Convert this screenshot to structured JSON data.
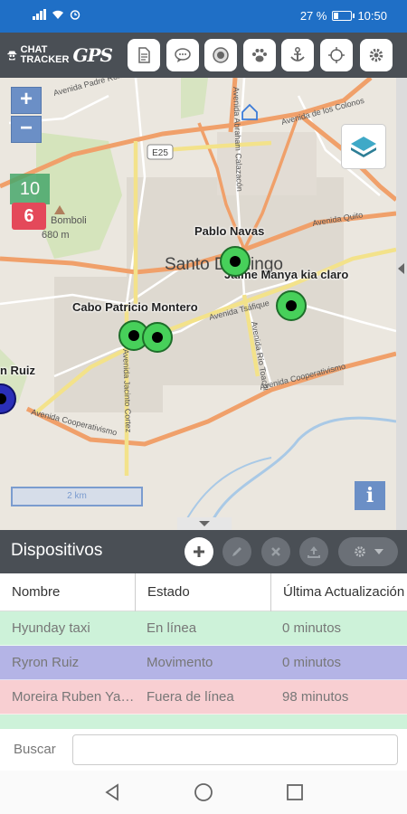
{
  "statusbar": {
    "battery_text": "27 %",
    "time": "10:50",
    "battery_level": 0.27
  },
  "toolbar": {
    "logo_text_line1": "CHAT",
    "logo_text_line2": "TRACKER",
    "logo_gps": "GPS",
    "buttons": [
      "report-icon",
      "chat-icon",
      "record-icon",
      "pawprint-icon",
      "anchor-icon",
      "crosshair-icon",
      "gear-icon"
    ]
  },
  "map": {
    "zoom_in": "+",
    "zoom_out": "−",
    "cluster_10": "10",
    "cluster_6": "6",
    "city_label": "Santo Domingo",
    "peak_name": "Bomboli",
    "peak_elev": "680 m",
    "road_e25": "E25",
    "roads": [
      "Avenida Quito",
      "Avenida Tsáfique",
      "Avenida Cooperativismo",
      "Avenida de los Colonos",
      "Avenida Río Toachi",
      "Avenida Jacinto Cortez",
      "Avenida Abraham Calazacón",
      "Avenida Padre Romero"
    ],
    "scale_text": "2 km",
    "info": "i",
    "devices": [
      {
        "label": "Pablo Navas"
      },
      {
        "label": "Jaime Manya kia claro"
      },
      {
        "label": "Cabo Patricio Montero"
      },
      {
        "label": "Ryron Ruiz",
        "visible": "n Ruiz"
      }
    ]
  },
  "devices_panel": {
    "title": "Dispositivos",
    "columns": [
      "Nombre",
      "Estado",
      "Última Actualización"
    ],
    "rows": [
      {
        "name": "Hyunday taxi",
        "status": "En línea",
        "updated": "0 minutos",
        "color": "#cdf2d9"
      },
      {
        "name": "Ryron Ruiz",
        "status": "Movimento",
        "updated": "0 minutos",
        "color": "#b4b4e6"
      },
      {
        "name": "Moreira Ruben Yayaya",
        "status": "Fuera de línea",
        "updated": "98 minutos",
        "color": "#f8cfd2"
      }
    ],
    "search_label": "Buscar",
    "search_value": ""
  },
  "colors": {
    "header": "#4a4f55",
    "status": "#1f6fc6",
    "marker": "#47d05a"
  }
}
